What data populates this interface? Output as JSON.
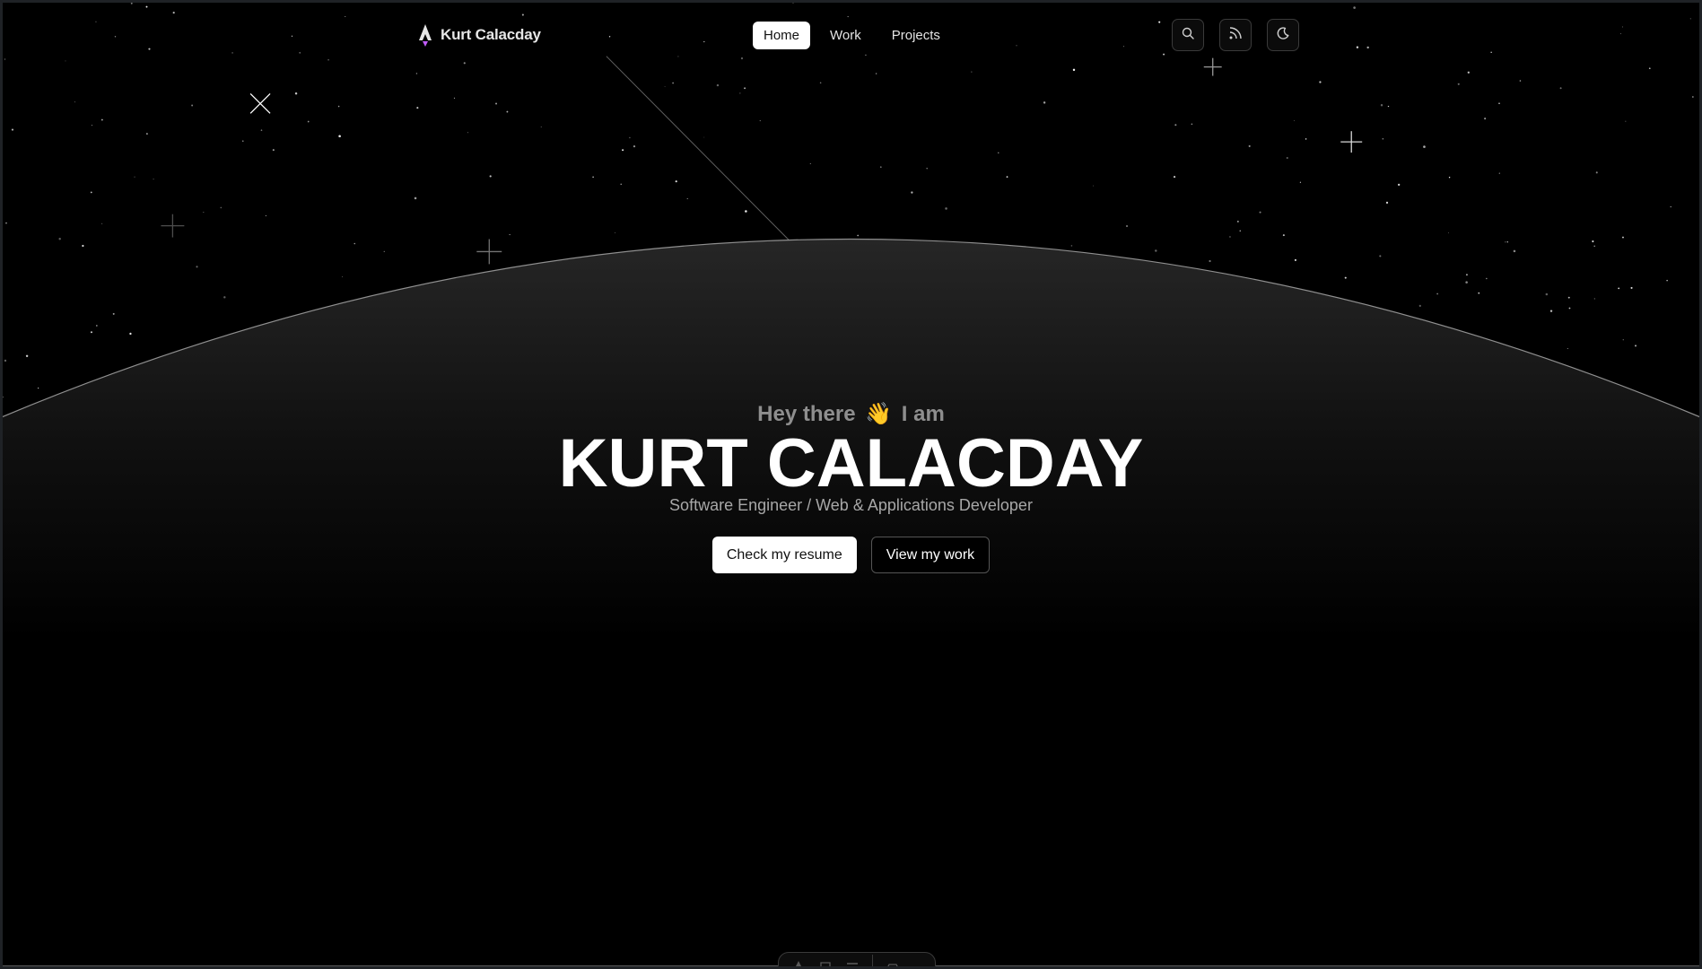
{
  "brand": {
    "name": "Kurt Calacday",
    "logo_icon": "rocket-logo-icon",
    "accent": "#c25cff"
  },
  "nav": {
    "items": [
      {
        "label": "Home",
        "active": true
      },
      {
        "label": "Work",
        "active": false
      },
      {
        "label": "Projects",
        "active": false
      }
    ]
  },
  "toolbar": {
    "icons": [
      "search-icon",
      "rss-icon",
      "moon-icon"
    ]
  },
  "hero": {
    "greeting_before": "Hey there",
    "wave": "👋",
    "greeting_after": "I am",
    "title": "KURT CALACDAY",
    "subtitle": "Software Engineer / Web & Applications Developer",
    "primary_button": "Check my resume",
    "secondary_button": "View my work"
  },
  "dock": {
    "icons": [
      "home-icon",
      "sign-icon",
      "minus-icon",
      "car-icon"
    ]
  },
  "colors": {
    "background": "#000000",
    "text": "#ffffff",
    "muted": "#8e8e8e",
    "horizon": "#9a9a9a"
  }
}
